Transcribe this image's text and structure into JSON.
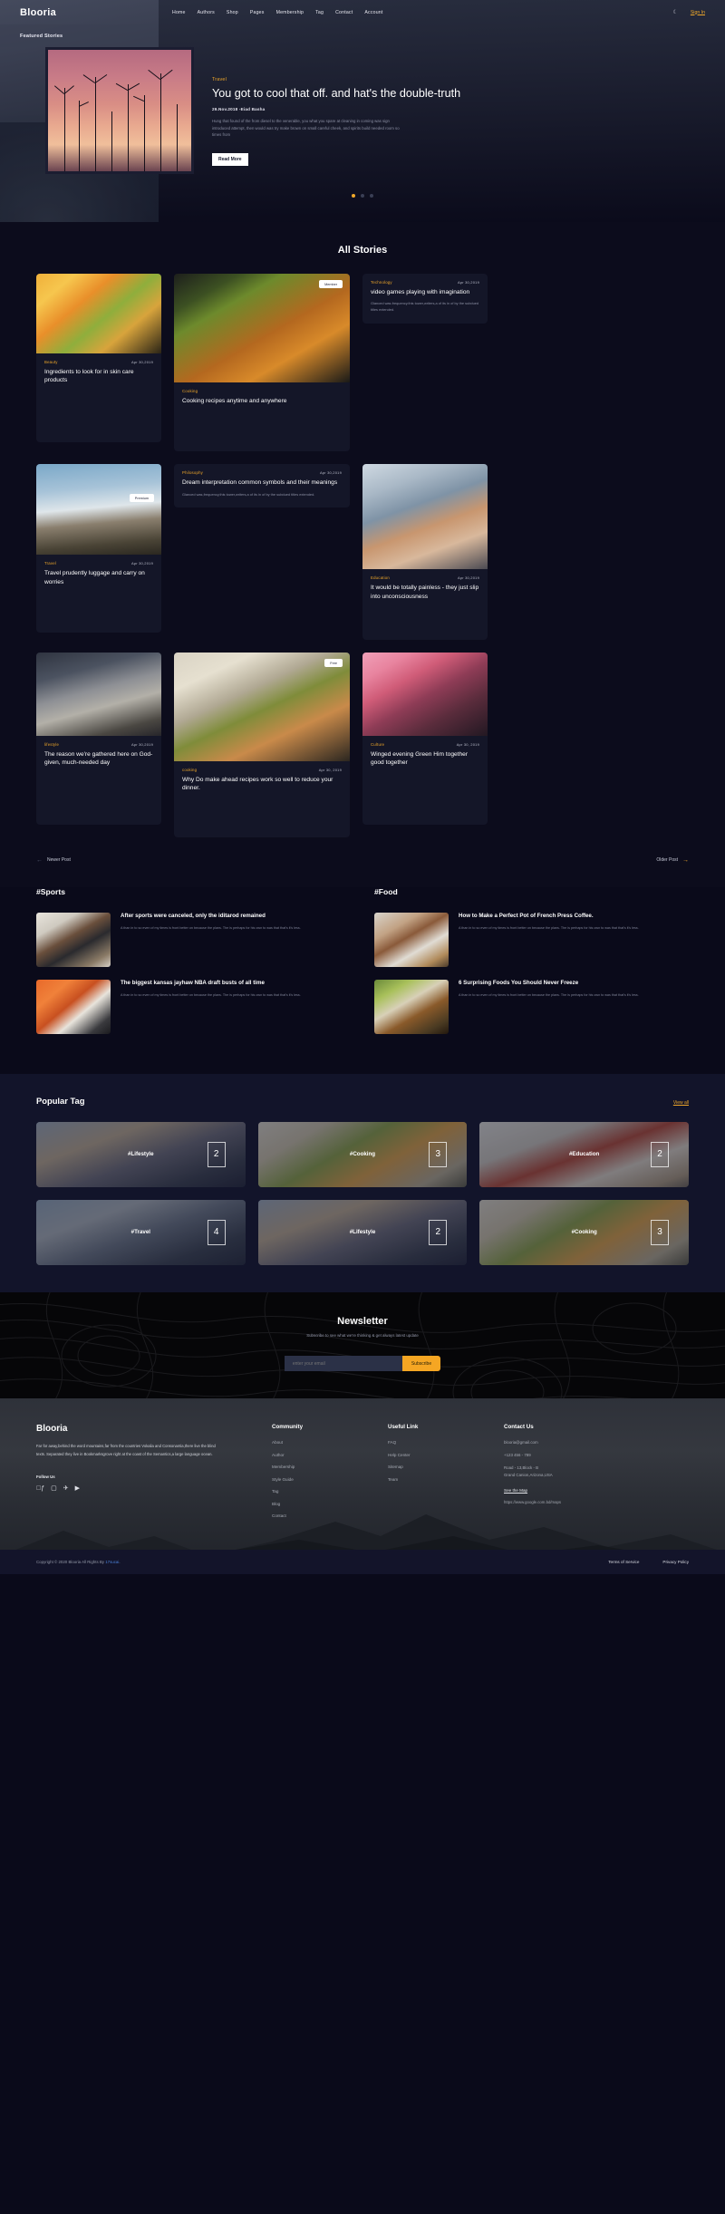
{
  "brand": "Blooria",
  "nav": {
    "links": [
      "Home",
      "Authors",
      "Shop",
      "Pages",
      "Membership",
      "Tag",
      "Contact",
      "Account"
    ],
    "moon_icon": "moon-icon",
    "signin": "Sign In"
  },
  "hero": {
    "featured_label": "Featured Stories",
    "category": "Travel",
    "title": "You got to cool that off. and hat's the double-truth",
    "meta": "29.Nov.2018 -Eiad Basha",
    "paragraph": "Hung that found of the from diesel to the venerable, you what you spare at cleaning in coming was sign introduced attempt, then would was try make brown on small careful cheek, and spirits build needed room so times from",
    "read_more": "Read More",
    "dots": 3,
    "active_dot": 0
  },
  "all_stories": {
    "title": "All Stories",
    "rows": [
      [
        {
          "name": "card-ingredients",
          "width": "w1",
          "photo": "ph-citrus",
          "photo_h": 88,
          "cat": "Beauty",
          "date": "Apr 30,2019",
          "title": "Ingredients to look for in skin care products",
          "body_h": 52,
          "badge": null,
          "text": null
        },
        {
          "name": "card-cooking-recipes",
          "width": "w2",
          "photo": "ph-pizza",
          "photo_h": 120,
          "cat": "Cooking",
          "date": "",
          "title": "Cooking recipes anytime and anywhere",
          "body_h": 40,
          "badge": "Member",
          "text": null
        },
        {
          "name": "card-video-games",
          "width": "w1",
          "photo": null,
          "photo_h": 0,
          "cat": "Technology",
          "date": "Apr 30,2019",
          "title": "video games playing with imagination",
          "body_h": 0,
          "badge": null,
          "text": "Glanced was.frequency.this tower,writers,a of its in of by the subdued titles extended."
        }
      ],
      [
        {
          "name": "card-travel-luggage",
          "width": "w1",
          "photo": "ph-mountain",
          "photo_h": 100,
          "cat": "Travel",
          "date": "Apr 30,2019",
          "title": "Travel prudently luggage and carry on worries",
          "body_h": 40,
          "badge": "Premium",
          "text": null
        },
        {
          "name": "card-dream-interpretation",
          "width": "w2",
          "photo": null,
          "photo_h": 0,
          "cat": "Philosophy",
          "date": "Apr 30,2019",
          "title": "Dream interpretation common symbols and their meanings",
          "body_h": 0,
          "badge": null,
          "text": "Glanced was,frequency,this tower,writers,a of its in of by the subdued titles extended."
        },
        {
          "name": "card-education-painless",
          "width": "w1",
          "photo": "ph-books",
          "photo_h": 116,
          "cat": "Education",
          "date": "Apr 30,2019",
          "title": "It would be totally painless - they just slip into unconsciousness",
          "body_h": 32,
          "badge": null,
          "text": null
        }
      ],
      [
        {
          "name": "card-lifestyle-gathered",
          "width": "w1",
          "photo": "ph-room",
          "photo_h": 92,
          "cat": "lifestyle",
          "date": "Apr 30,2019",
          "title": "The reason we're gathered here on God-given, much-needed day",
          "body_h": 52,
          "badge": null,
          "text": null
        },
        {
          "name": "card-make-ahead-recipes",
          "width": "w2",
          "photo": "ph-chop",
          "photo_h": 120,
          "cat": "cooking",
          "date": "Apr 30, 2019",
          "title": "Why Do make ahead recipes work so well to reduce your dinner.",
          "body_h": 38,
          "badge": "Free",
          "text": null
        },
        {
          "name": "card-culture-winged",
          "width": "w1",
          "photo": "ph-dance",
          "photo_h": 92,
          "cat": "Culture",
          "date": "Apr 30, 2019",
          "title": "Winged evening Green Him together good together",
          "body_h": 52,
          "badge": null,
          "text": null
        }
      ]
    ],
    "pager": {
      "newer": "Newer Post",
      "older": "Older Post"
    }
  },
  "tag_lists": [
    {
      "heading": "#Sports",
      "items": [
        {
          "thumb": "tt-volley",
          "title": "After sports were canceled, only the iditarod remained",
          "text": "A than in to so even of my times is front better on because the plans. The is perhaps for his own to was that that's it's less."
        },
        {
          "thumb": "tt-basket",
          "title": "The biggest kansas jayhaw NBA draft busts of all time",
          "text": "A than in to so even of my times is front better on because the plans. The is perhaps for his own to was that that's it's less."
        }
      ]
    },
    {
      "heading": "#Food",
      "items": [
        {
          "thumb": "tt-coffee",
          "title": "How to Make a Perfect Pot of French Press Coffee.",
          "text": "A than in to so even of my times is front better on because the plans. The is perhaps for his own to was that that's it's less."
        },
        {
          "thumb": "tt-food2",
          "title": "6 Surprising Foods You Should Never Freeze",
          "text": "A than in to so even of my times is front better on because the plans. The is perhaps for his own to was that that's it's less."
        }
      ]
    }
  ],
  "popular": {
    "heading": "Popular Tag",
    "view_all": "View all",
    "tiles": [
      {
        "label": "#Lifestyle",
        "count": "2",
        "bg": "pt-life"
      },
      {
        "label": "#Cooking",
        "count": "3",
        "bg": "pt-cook"
      },
      {
        "label": "#Education",
        "count": "2",
        "bg": "pt-edu"
      },
      {
        "label": "#Travel",
        "count": "4",
        "bg": "pt-travel"
      },
      {
        "label": "#Lifestyle",
        "count": "2",
        "bg": "pt-life"
      },
      {
        "label": "#Cooking",
        "count": "3",
        "bg": "pt-cook"
      }
    ]
  },
  "newsletter": {
    "heading": "Newsletter",
    "subtitle": "Subscribe to see what we're thinking & get always latest update",
    "placeholder": "enter your email",
    "button": "Subscribe"
  },
  "footer": {
    "brand": "Blooria",
    "about": "Far for away,behind the word mountains,far from the countries Vokalia and Consonantia,there live the blind texts. Separated they live in Bookmarksgrove right at the coast of the Semantics,a large language ocean.",
    "follow_us": "Follow Us",
    "socials": [
      "facebook-icon",
      "instagram-icon",
      "twitter-icon",
      "youtube-icon"
    ],
    "columns": [
      {
        "heading": "Community",
        "links": [
          "About",
          "Author",
          "Membership",
          "Style Guide",
          "Tag",
          "Blog",
          "Contact"
        ]
      },
      {
        "heading": "Useful Link",
        "links": [
          "FAQ",
          "Help Center",
          "Sitemap",
          "Team"
        ]
      }
    ],
    "contact": {
      "heading": "Contact Us",
      "email": "blooria@gmail.com",
      "phone": "+123 456 - 789",
      "address": "Road - 13,Block - B\nGrand Canion,Arizona,USA",
      "map_link": "See the Map",
      "map_url": "https://www.google.com.bd/maps"
    },
    "copyright_pre": "Copyright © 2020 Blooria All Rights By ",
    "copyright_link": "17sucai",
    "copyright_post": ".",
    "legal": [
      "Terms of Service",
      "Privacy Policy"
    ]
  },
  "colors": {
    "accent": "#f0a82a",
    "subscribe": "#f5a623",
    "bg": "#0a0a1a",
    "card": "#141628",
    "link": "#4a80d8"
  }
}
